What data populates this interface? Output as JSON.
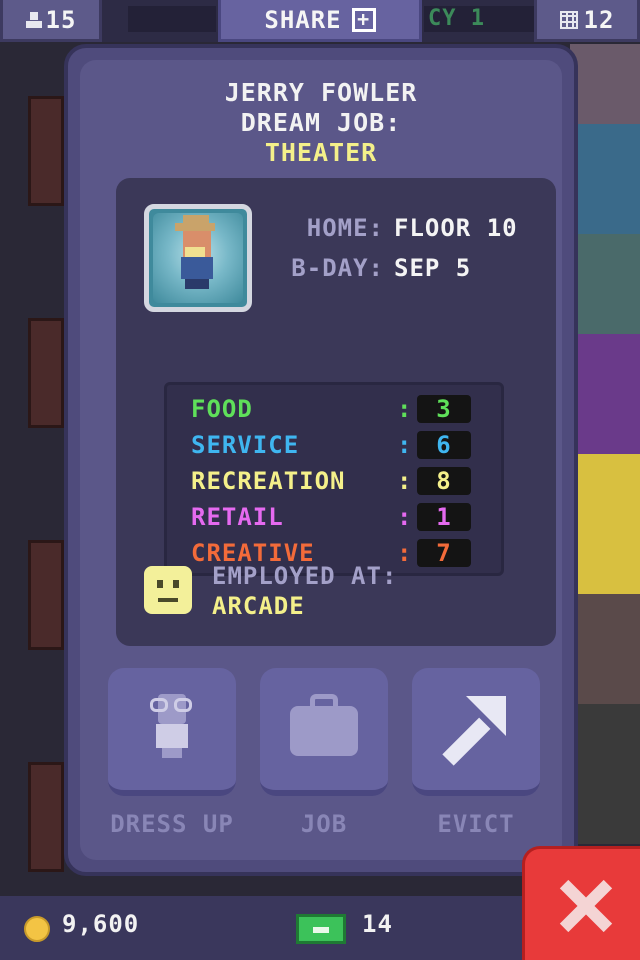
{
  "topbar": {
    "population": "15",
    "share_label": "SHARE",
    "share_icon": "+",
    "ticker_text": "CY 1",
    "floors": "12"
  },
  "resident": {
    "name": "JERRY FOWLER",
    "dream_job_label": "DREAM JOB:",
    "dream_job": "THEATER",
    "home_label": "HOME:",
    "home_value": "FLOOR 10",
    "bday_label": "B-DAY:",
    "bday_value": "SEP 5",
    "stats": [
      {
        "label": "FOOD",
        "value": "3",
        "color": "#5fe05a"
      },
      {
        "label": "SERVICE",
        "value": "6",
        "color": "#3fb6f0"
      },
      {
        "label": "RECREATION",
        "value": "8",
        "color": "#f4f08a"
      },
      {
        "label": "RETAIL",
        "value": "1",
        "color": "#e56af0"
      },
      {
        "label": "CREATIVE",
        "value": "7",
        "color": "#f36b3a"
      }
    ],
    "employed_label": "EMPLOYED AT:",
    "employed_value": "ARCADE"
  },
  "actions": {
    "dress_up": "DRESS UP",
    "job": "JOB",
    "evict": "EVICT"
  },
  "bottombar": {
    "coins": "9,600",
    "bux": "14"
  },
  "icons": [
    "population-icon",
    "share-icon",
    "floors-icon",
    "avatar",
    "smiley-icon",
    "suit-icon",
    "briefcase-icon",
    "evict-arrow-icon",
    "coin-icon",
    "bux-icon",
    "close-icon"
  ],
  "colors": {
    "panel": "#5b5789",
    "card": "#3b3858",
    "close": "#e83a3a",
    "accent_yellow": "#f4f08a"
  }
}
